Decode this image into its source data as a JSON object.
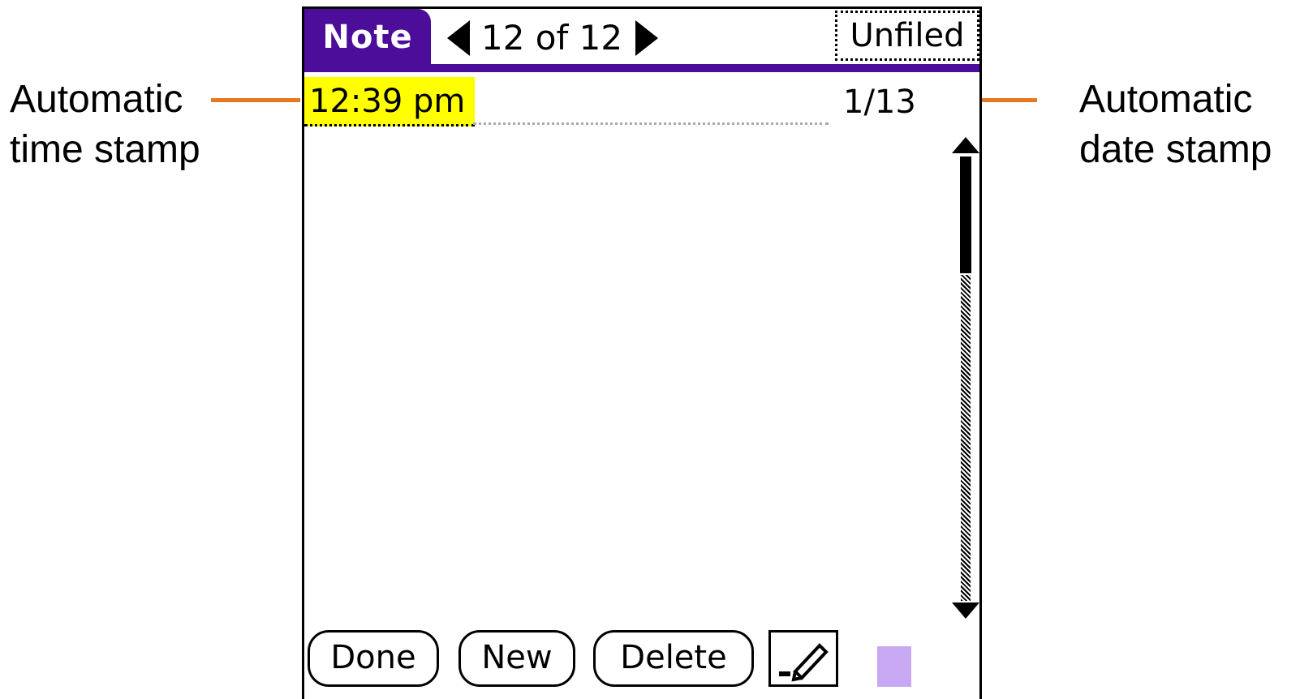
{
  "callouts": {
    "left_line1": "Automatic",
    "left_line2": "time stamp",
    "right_line1": "Automatic",
    "right_line2": "date stamp"
  },
  "header": {
    "title": "Note",
    "record_count": "12 of 12",
    "category": "Unfiled"
  },
  "note": {
    "time_stamp": "12:39 pm",
    "date_stamp": "1/13"
  },
  "buttons": {
    "done": "Done",
    "new": "New",
    "delete": "Delete"
  },
  "colors": {
    "title_bar": "#4b0d9a",
    "time_highlight": "#ffff00",
    "callout_line": "#e87722",
    "note_color": "#c8a8f2"
  }
}
